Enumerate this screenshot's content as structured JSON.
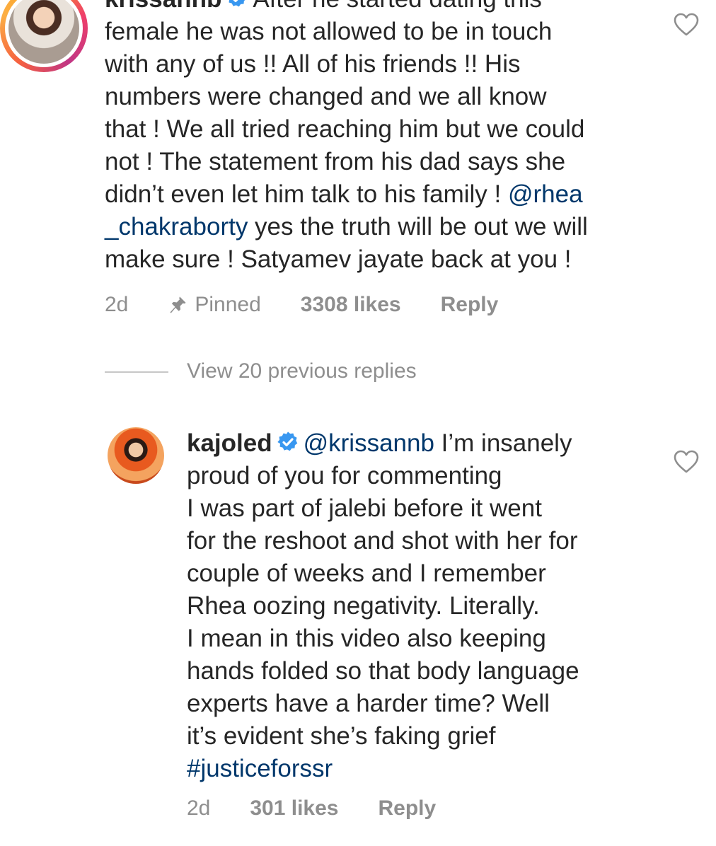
{
  "comment1": {
    "username": "krissannb",
    "lines": [
      "After he started dating this",
      "female he was not allowed to be in touch",
      "with any of us !! All of his friends !! His",
      "numbers were changed and we all know",
      "that ! We all tried reaching him but we could",
      "not ! The statement from his dad says she",
      "didn’t even let him talk to his family ! "
    ],
    "mention_a": "@rhea",
    "mention_b": "_chakraborty",
    "line8_rest": " yes the truth will be out we will",
    "line9": "make sure ! Satyamev jayate back at you !",
    "age": "2d",
    "pinned": "Pinned",
    "likes": "3308 likes",
    "reply": "Reply"
  },
  "view_replies": "View 20 previous replies",
  "comment2": {
    "username": "kajoled",
    "mention": "@krissannb",
    "first_rest": " I’m insanely",
    "lines": [
      "proud of you for commenting",
      "I was part of jalebi before it went",
      "for the reshoot and shot with her for",
      "couple of weeks and I remember",
      "Rhea oozing negativity. Literally.",
      "I mean in this video also keeping",
      "hands folded so that body language",
      "experts have a harder time? Well",
      "it’s evident she’s faking grief"
    ],
    "hashtag": "#justiceforssr",
    "age": "2d",
    "likes": "301 likes",
    "reply": "Reply"
  },
  "colors": {
    "text": "#262626",
    "link": "#00376b",
    "meta": "#8e8e8e",
    "verified": "#3897f0"
  },
  "icons": {
    "verified": "verified-badge-icon",
    "heart": "heart-outline-icon",
    "pin": "pin-icon"
  }
}
